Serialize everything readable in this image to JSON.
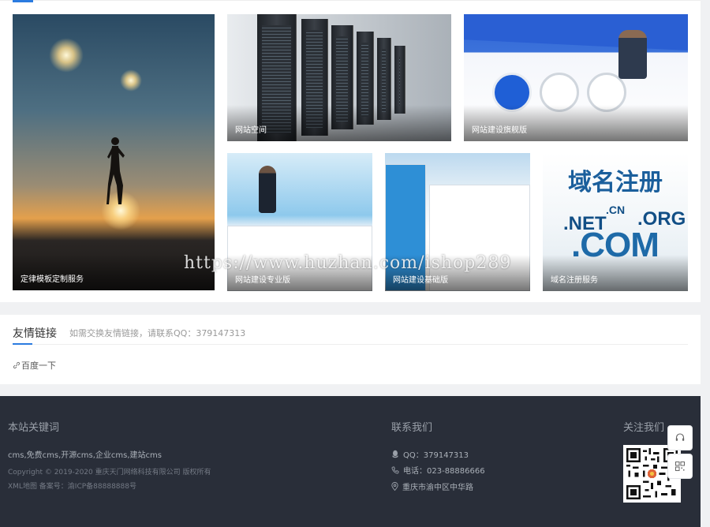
{
  "gallery": {
    "tiles": [
      {
        "caption": "定律模板定制服务"
      },
      {
        "caption": "网站空间"
      },
      {
        "caption": "网站建设旗舰版"
      },
      {
        "caption": "网站建设专业版"
      },
      {
        "caption": "网站建设基础版"
      },
      {
        "caption": "域名注册服务"
      }
    ],
    "domain_image_text": {
      "headline": "域名注册",
      "net": ".NET",
      "cn": ".CN",
      "org": ".ORG",
      "com": ".COM"
    }
  },
  "watermark": "https://www.huzhan.com/ishop289",
  "links": {
    "title": "友情链接",
    "note": "如需交换友情链接，请联系QQ：379147313",
    "items": [
      {
        "label": "百度一下"
      }
    ]
  },
  "footer": {
    "keywords_title": "本站关键词",
    "keywords": "cms,免费cms,开源cms,企业cms,建站cms",
    "copyright": "Copyright © 2019-2020 重庆天门网络科技有限公司 版权所有",
    "icp": "XML地图   备案号：渝ICP备88888888号",
    "contact_title": "联系我们",
    "qq": "QQ：379147313",
    "phone": "电话：023-88886666",
    "address": "重庆市渝中区中华路",
    "follow_title": "关注我们"
  },
  "colors": {
    "accent": "#2b7be0",
    "footer_bg": "#292e39"
  },
  "icons": {
    "qq": "qq-icon",
    "phone": "phone-icon",
    "location": "location-icon",
    "link": "link-icon",
    "headset": "headset-icon",
    "qrcode": "qrcode-icon"
  }
}
